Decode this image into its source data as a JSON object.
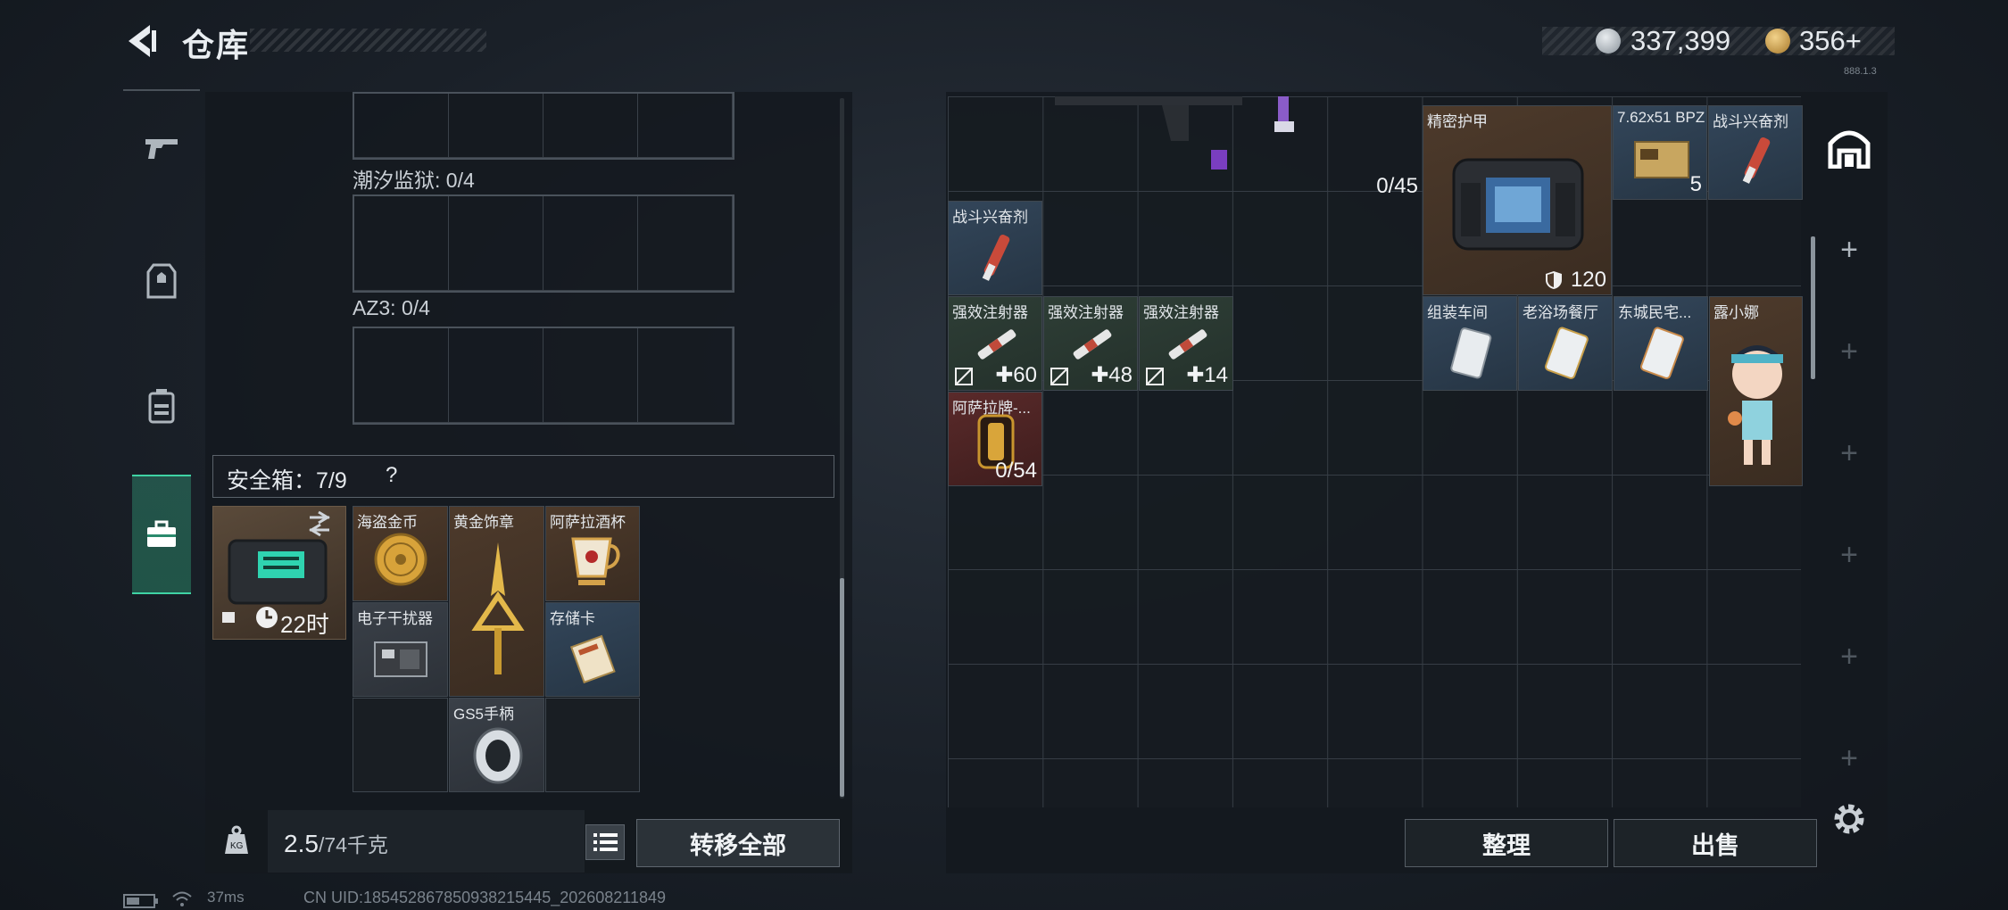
{
  "header": {
    "title": "仓库",
    "silver_amount": "337,399",
    "gold_amount": "356",
    "gold_plus": "+",
    "version_tag": "888.1.3"
  },
  "left_nav": {
    "items": [
      "weapon-icon",
      "armor-icon",
      "backpack-icon",
      "safebox-icon"
    ],
    "active_index": 3
  },
  "left_panel": {
    "sections": [
      {
        "label": "潮汐监狱: 0/4"
      },
      {
        "label": "AZ3: 0/4"
      }
    ],
    "safe_box": {
      "label": "安全箱：7/9",
      "help": "?",
      "time_left": "22时",
      "items": [
        {
          "label": "海盗金币",
          "qty": ""
        },
        {
          "label": "黄金饰章",
          "qty": ""
        },
        {
          "label": "阿萨拉酒杯",
          "qty": ""
        },
        {
          "label": "电子干扰器",
          "qty": ""
        },
        {
          "label": "存储卡",
          "qty": ""
        },
        {
          "label": "GS5手柄",
          "qty": ""
        }
      ]
    },
    "weight": {
      "value": "2.5",
      "capacity": "/74千克"
    },
    "transfer_all_label": "转移全部"
  },
  "right_panel": {
    "items": [
      {
        "label": "",
        "qty": "0/45"
      },
      {
        "label": "精密护甲",
        "qty": "120"
      },
      {
        "label": "7.62x51 BPZ",
        "qty": "5"
      },
      {
        "label": "战斗兴奋剂",
        "qty": ""
      },
      {
        "label": "战斗兴奋剂",
        "qty": ""
      },
      {
        "label": "强效注射器",
        "qty": "60"
      },
      {
        "label": "强效注射器",
        "qty": "48"
      },
      {
        "label": "强效注射器",
        "qty": "14"
      },
      {
        "label": "组装车间",
        "qty": ""
      },
      {
        "label": "老浴场餐厅",
        "qty": ""
      },
      {
        "label": "东城民宅...",
        "qty": ""
      },
      {
        "label": "露小娜",
        "qty": ""
      },
      {
        "label": "阿萨拉牌-...",
        "qty": "0/54"
      }
    ],
    "organize_label": "整理",
    "sell_label": "出售"
  },
  "right_rail": {
    "items": [
      "+",
      "+",
      "+",
      "+",
      "+",
      "+"
    ]
  },
  "footer": {
    "ping": "37ms",
    "uid": "CN UID:18545286785093821544​5_202608211849"
  },
  "colors": {
    "accent_green": "#3fd3a4",
    "bg_dark": "#1a2028",
    "rarity_brown": "#4d3a2b",
    "rarity_blue": "#33465a",
    "rarity_red": "#5a2a2a"
  }
}
